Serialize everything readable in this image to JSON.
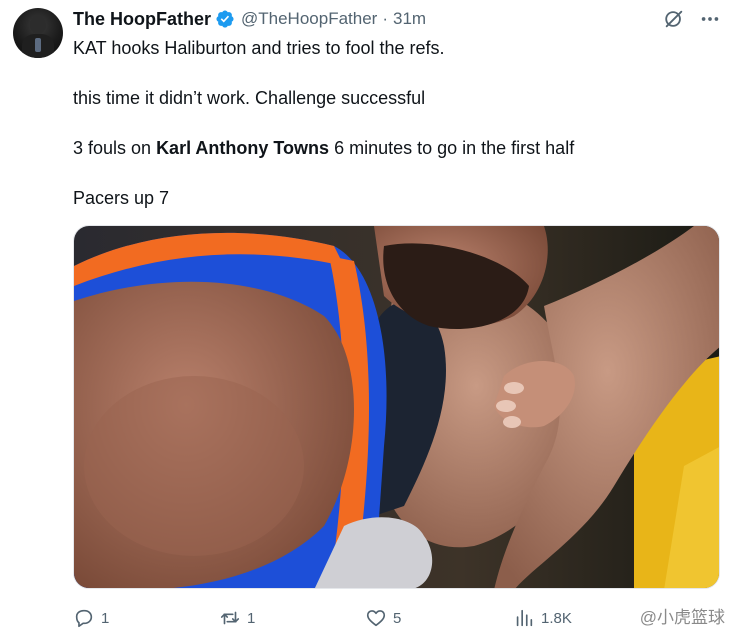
{
  "author": {
    "display_name": "The HoopFather",
    "handle": "@TheHoopFather",
    "separator": "·",
    "time": "31m"
  },
  "tweet": {
    "lines": [
      "KAT hooks Haliburton and tries to fool the refs.",
      "this time it didn’t work. Challenge successful"
    ],
    "fouls_prefix": "3 fouls on ",
    "fouls_player": "Karl Anthony Towns",
    "fouls_suffix": " 6 minutes to go in the first half",
    "last_line": "Pacers up 7"
  },
  "actions": {
    "replies": "1",
    "reposts": "1",
    "likes": "5",
    "views": "1.8K"
  },
  "watermark": {
    "text": "@小虎篮球"
  },
  "icons": {
    "verified": "verified-badge-icon",
    "grok": "grok-icon",
    "more": "more-icon",
    "reply": "reply-icon",
    "repost": "repost-icon",
    "like": "heart-icon",
    "views": "views-icon"
  },
  "colors": {
    "verified_blue": "#1d9bf0",
    "secondary_text": "#536471",
    "knicks_blue": "#1d4fd8",
    "knicks_orange": "#f26b21",
    "pacers_yellow": "#e8b518"
  }
}
